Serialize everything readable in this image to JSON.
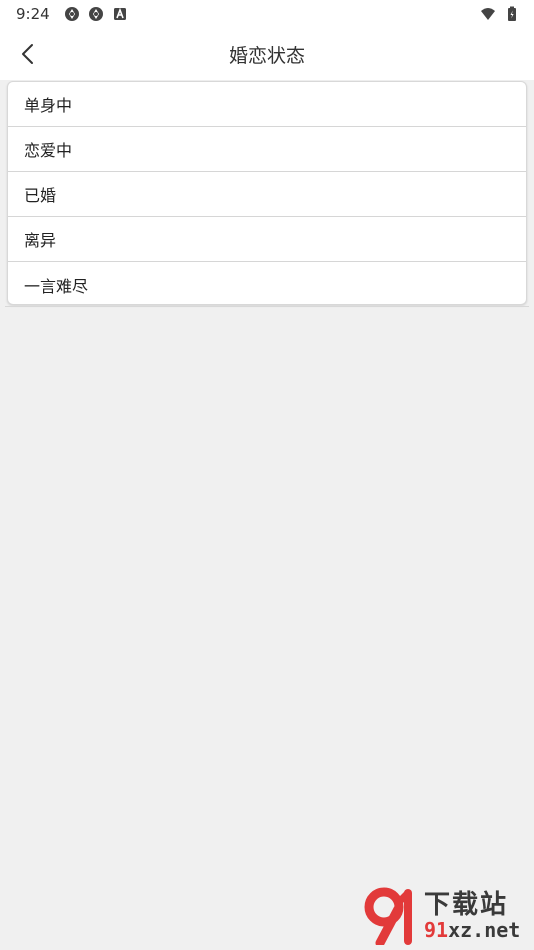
{
  "status_bar": {
    "time": "9:24",
    "left_icons": [
      "aperture-icon",
      "aperture-icon",
      "a-badge-icon"
    ],
    "right_icons": [
      "wifi-icon",
      "battery-icon"
    ]
  },
  "header": {
    "title": "婚恋状态",
    "back_icon": "chevron-left-icon"
  },
  "options": [
    {
      "label": "单身中"
    },
    {
      "label": "恋爱中"
    },
    {
      "label": "已婚"
    },
    {
      "label": "离异"
    },
    {
      "label": "一言难尽"
    }
  ],
  "watermark": {
    "cn": "下载站",
    "en_prefix": "91",
    "en_rest": "xz.net"
  },
  "colors": {
    "background": "#f0f0f0",
    "surface": "#ffffff",
    "divider": "#d6d6d6",
    "watermark_red": "#e23a3a"
  }
}
